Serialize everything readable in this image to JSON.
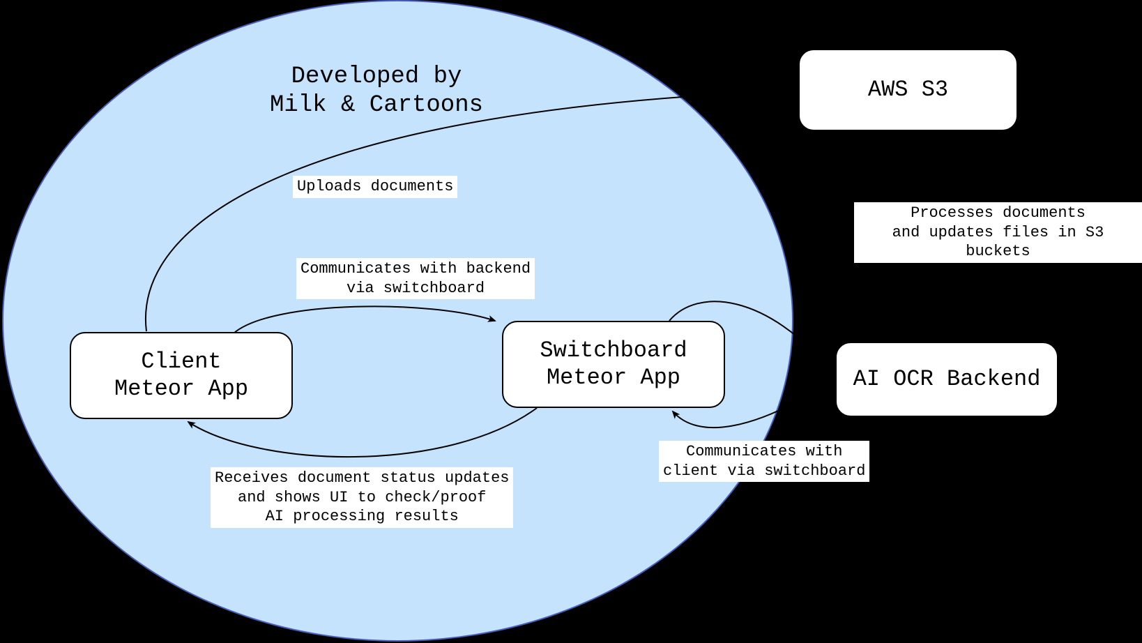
{
  "group": {
    "title_line1": "Developed by",
    "title_line2": "Milk & Cartoons"
  },
  "nodes": {
    "client": {
      "line1": "Client",
      "line2": "Meteor App"
    },
    "switchboard": {
      "line1": "Switchboard",
      "line2": "Meteor App"
    },
    "aws_s3": "AWS S3",
    "ai_ocr": "AI OCR Backend"
  },
  "edges": {
    "uploads": "Uploads documents",
    "comm_backend_line1": "Communicates with backend",
    "comm_backend_line2": "via switchboard",
    "receives_line1": "Receives document status updates",
    "receives_line2": "and shows UI to check/proof",
    "receives_line3": "AI processing results",
    "comm_client_line1": "Communicates with",
    "comm_client_line2": "client via switchboard",
    "processes_line1": "Processes documents",
    "processes_line2": "and updates files in S3 buckets"
  }
}
